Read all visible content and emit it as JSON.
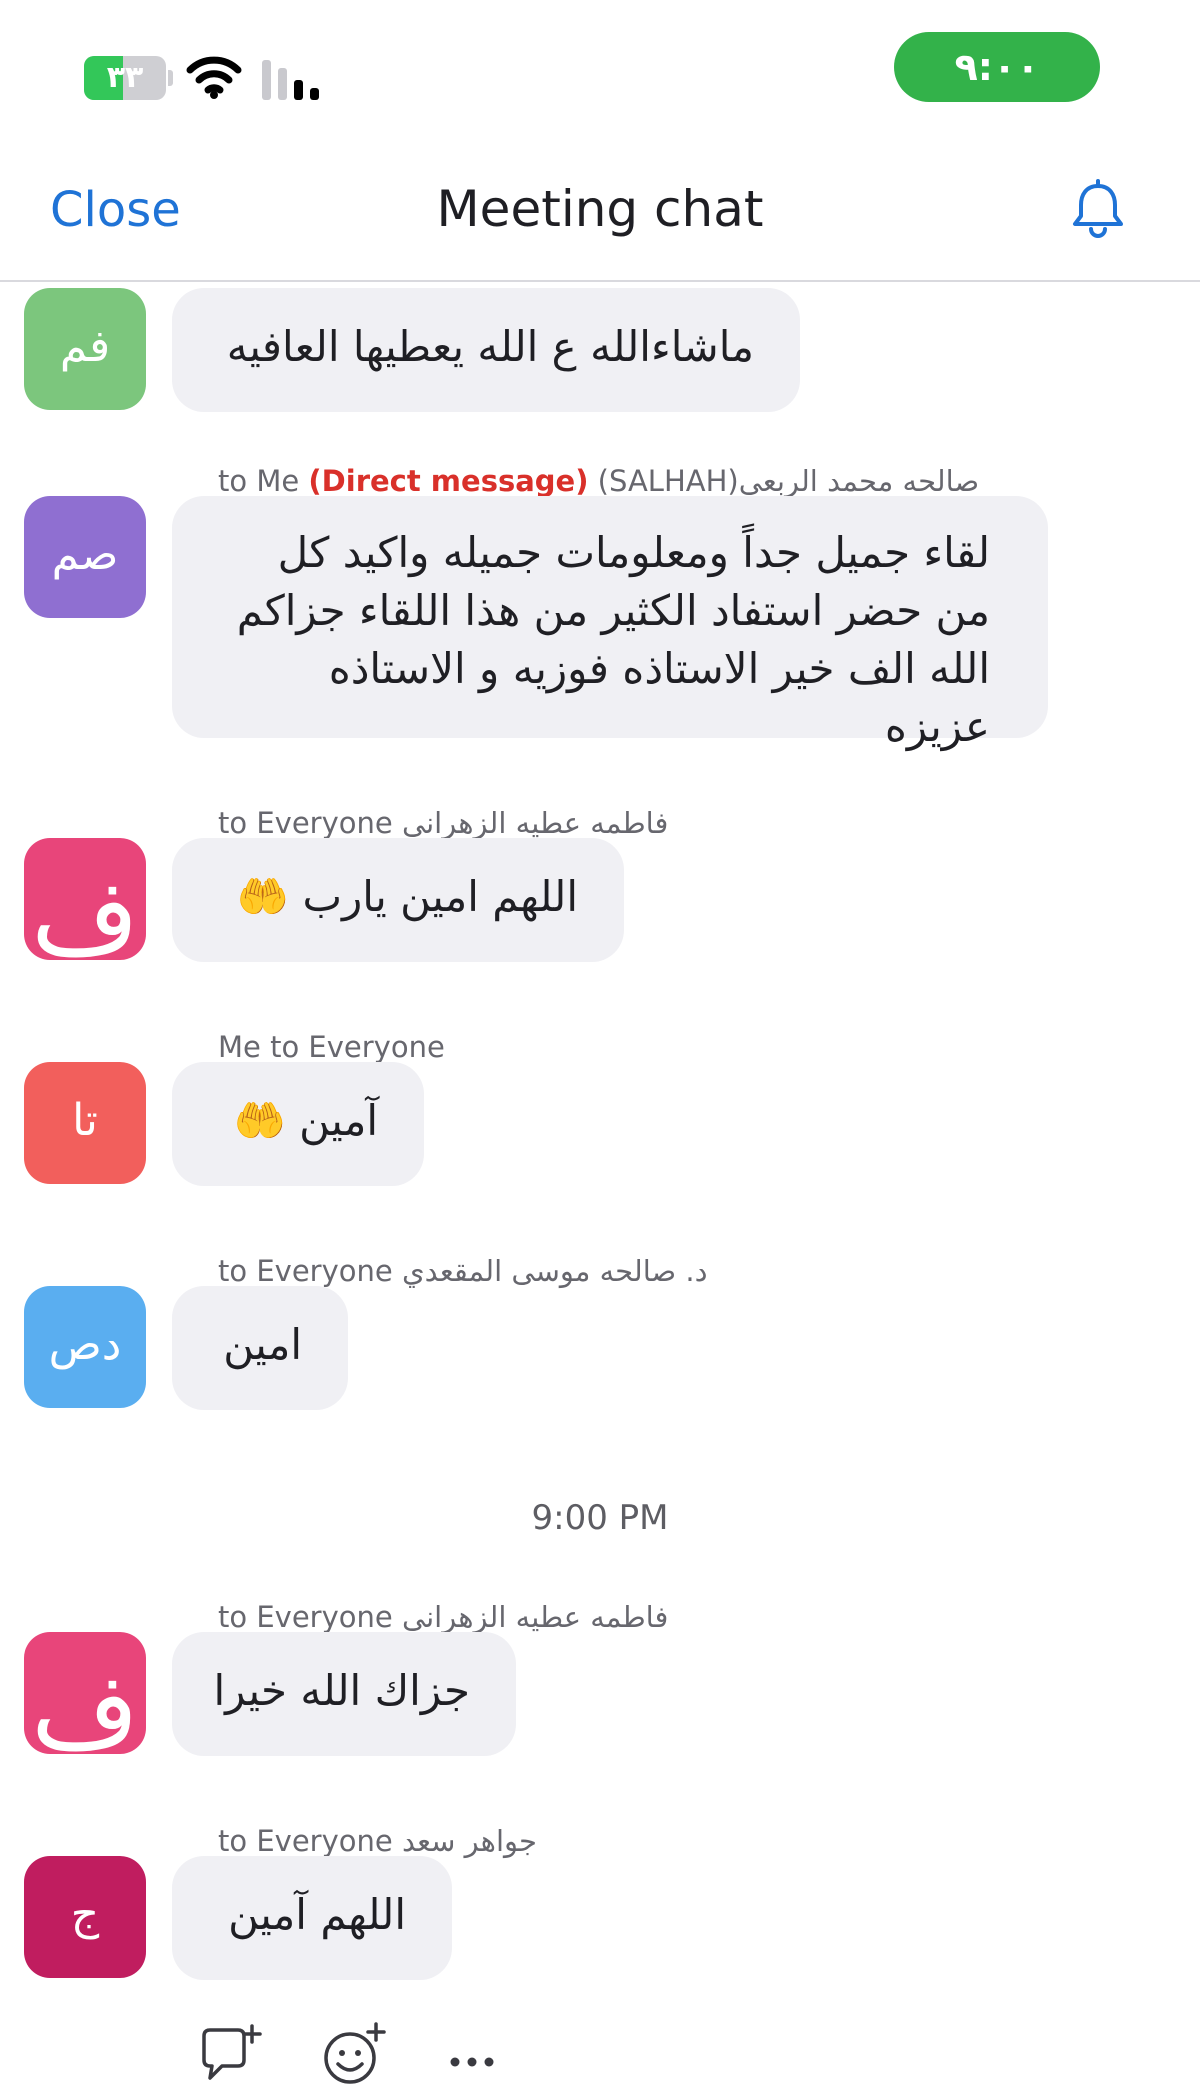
{
  "status_bar": {
    "battery_text": "٣٣",
    "battery_percent": 33,
    "clock": "٩:٠٠",
    "icons": [
      "battery-icon",
      "wifi-icon",
      "cellular-signal-icon"
    ],
    "clock_pill_color": "#33b24a"
  },
  "header": {
    "close_label": "Close",
    "title": "Meeting chat",
    "bell_icon": "bell-icon",
    "accent_color": "#1f73d6"
  },
  "messages": [
    {
      "sender": "",
      "avatar_initials": "فم",
      "avatar_color": "#7cc67d",
      "text": "ماشاءالله ع الله يعطيها العافيه"
    },
    {
      "sender_prefix": "to Me ",
      "direct_label": "(Direct message)",
      "sender_name": " (SALHAH)صالحه محمد الربعي",
      "avatar_initials": "صم",
      "avatar_color": "#8f6fd1",
      "text": "لقاء جميل جداً ومعلومات جميله واكيد كل من حضر استفاد الكثير من هذا اللقاء جزاكم الله الف خير الاستاذه فوزيه و الاستاذه عزيزه"
    },
    {
      "sender": "to Everyone فاطمه عطيه الزهراني",
      "avatar_initials": "ف",
      "avatar_color": "#e8457a",
      "text": "اللهم امين يارب 🤲"
    },
    {
      "sender": "Me to Everyone",
      "avatar_initials": "تا",
      "avatar_color": "#f25f5c",
      "text": "آمين 🤲"
    },
    {
      "sender": "to Everyone د. صالحه موسى المقعدي",
      "avatar_initials": "دص",
      "avatar_color": "#5aaef0",
      "text": "امين"
    },
    {
      "sender": "to Everyone فاطمه عطيه الزهراني",
      "avatar_initials": "ف",
      "avatar_color": "#e8457a",
      "text": "جزاك الله خيرا"
    },
    {
      "sender": "to Everyone جواهر سعد",
      "avatar_initials": "ج",
      "avatar_color": "#c01d5f",
      "text": "اللهم آمين"
    }
  ],
  "timestamp": "9:00 PM",
  "actions": {
    "icons": [
      "reply-icon",
      "add-reaction-icon",
      "more-icon"
    ]
  }
}
